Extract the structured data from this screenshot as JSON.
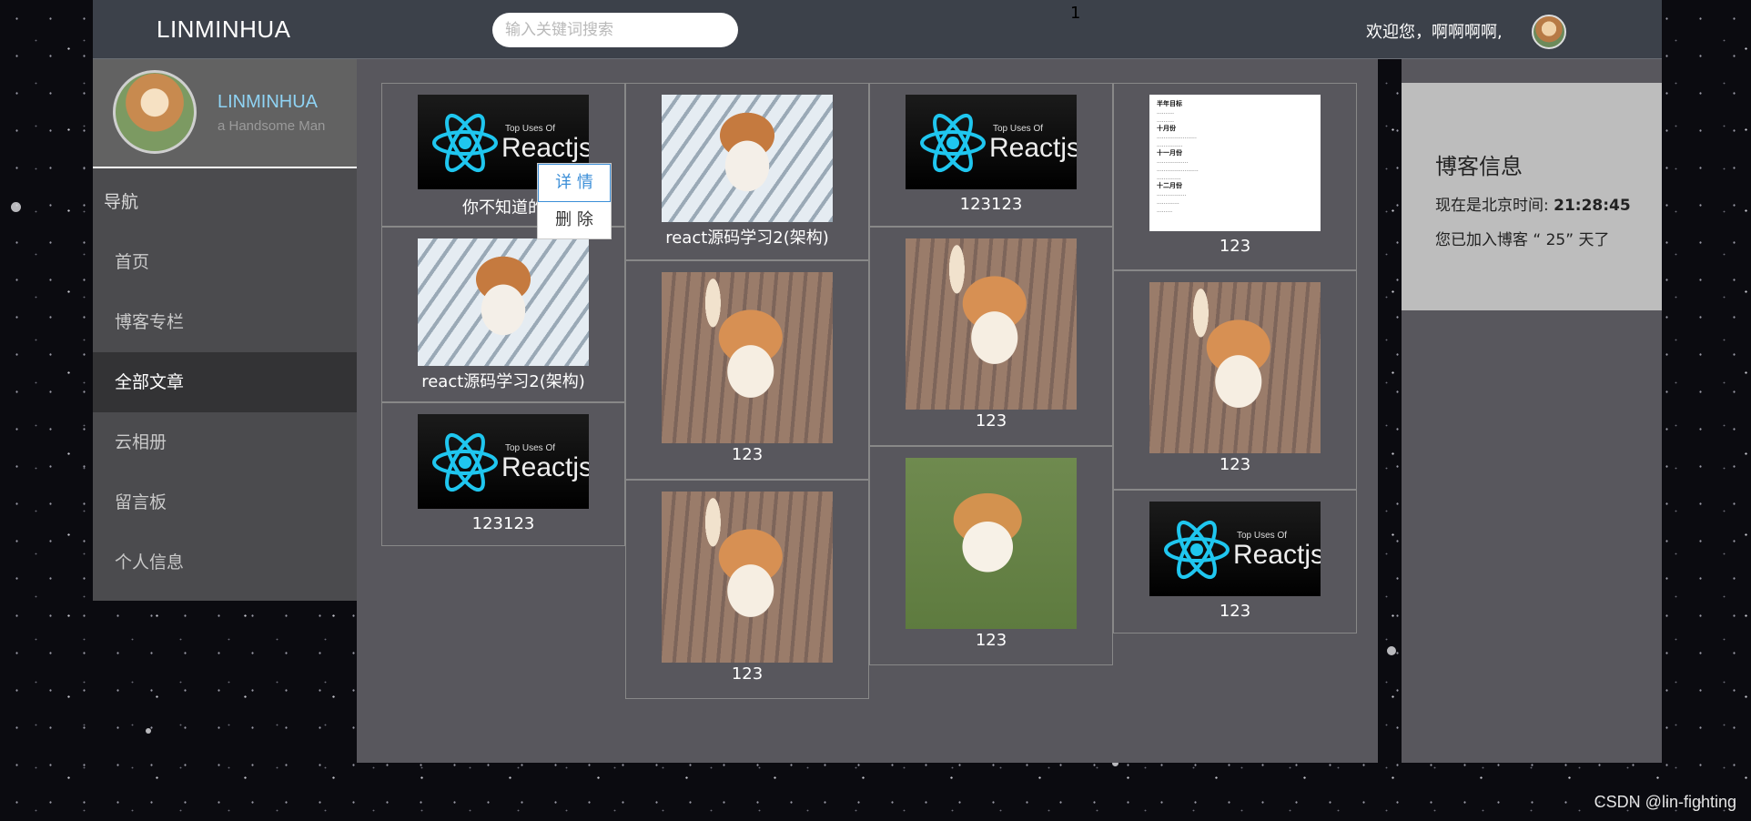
{
  "header": {
    "brand": "LINMINHUA",
    "search_placeholder": "输入关键词搜索",
    "page_num": "1",
    "welcome": "欢迎您，啊啊啊啊,"
  },
  "profile": {
    "name": "LINMINHUA",
    "subtitle": "a Handsome Man"
  },
  "nav": {
    "title": "导航",
    "items": [
      {
        "label": "首页"
      },
      {
        "label": "博客专栏"
      },
      {
        "label": "全部文章"
      },
      {
        "label": "云相册"
      },
      {
        "label": "留言板"
      },
      {
        "label": "个人信息"
      }
    ],
    "active": "全部文章"
  },
  "react_logo": {
    "small": "Top Uses Of",
    "big": "Reactjs"
  },
  "cards": [
    {
      "caption": "你不知道的"
    },
    {
      "caption": "react源码学习2(架构)"
    },
    {
      "caption": "123123"
    },
    {
      "caption": "react源码学习2(架构)"
    },
    {
      "caption": "123"
    },
    {
      "caption": "123"
    },
    {
      "caption": "123123"
    },
    {
      "caption": "123"
    },
    {
      "caption": "123"
    },
    {
      "caption": "123"
    },
    {
      "caption": "123"
    },
    {
      "caption": "123"
    }
  ],
  "doc_thumb": {
    "lines": [
      "半年目标",
      "十月份",
      "十一月份",
      "十二月份"
    ]
  },
  "popup": {
    "detail": "详 情",
    "delete": "删 除"
  },
  "blog_info": {
    "title": "博客信息",
    "time_label": "现在是北京时间: ",
    "time_value": "21:28:45",
    "days": "您已加入博客 “ 25” 天了"
  },
  "watermark": "CSDN @lin-fighting"
}
